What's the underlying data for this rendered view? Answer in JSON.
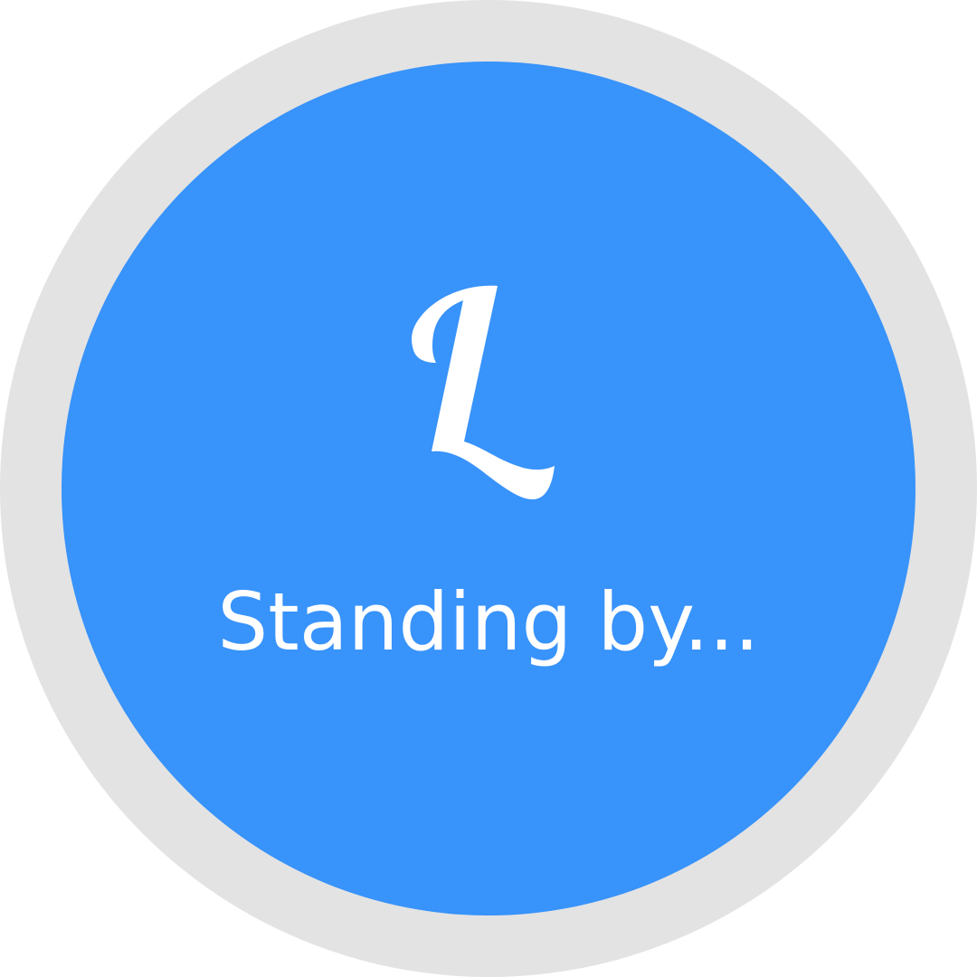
{
  "colors": {
    "ring": "#e3e3e3",
    "disc": "#3893fa",
    "foreground": "#ffffff"
  },
  "logo": {
    "icon": "script-letter-l-icon"
  },
  "status": {
    "label": "Standing by..."
  }
}
